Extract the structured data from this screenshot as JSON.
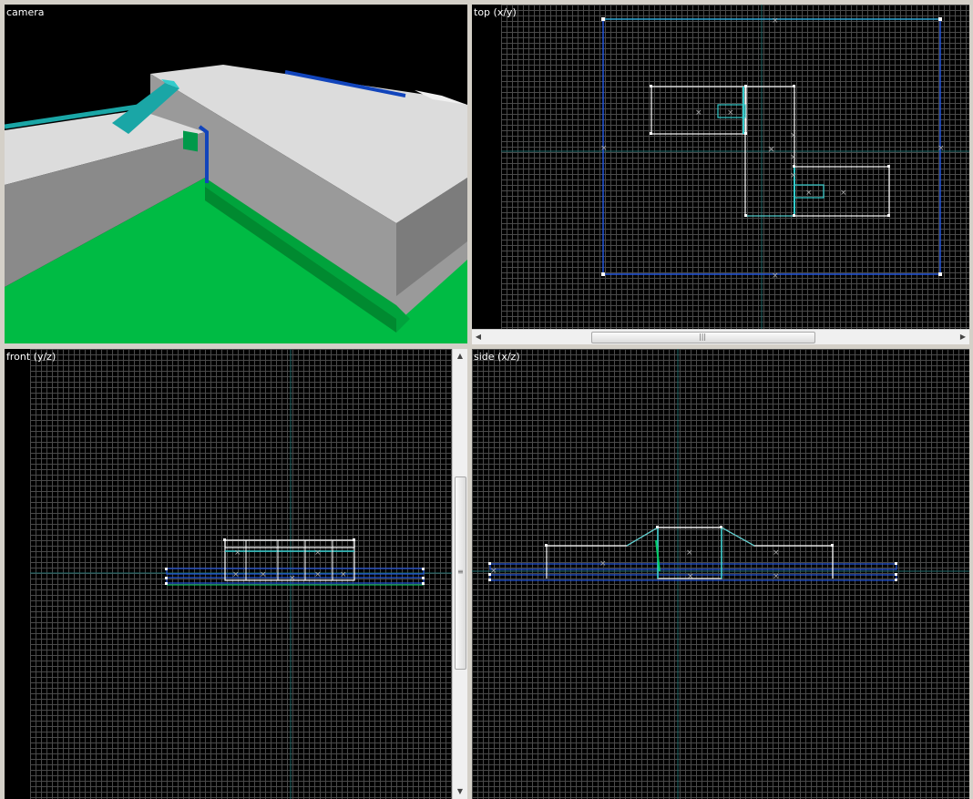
{
  "viewports": {
    "camera": {
      "label": "camera"
    },
    "top": {
      "label": "top (x/y)"
    },
    "front": {
      "label": "front (y/z)"
    },
    "side": {
      "label": "side (x/z)"
    }
  },
  "colors": {
    "background": "#000000",
    "grid_line": "#4a4a4a",
    "brush_white": "#ffffff",
    "brush_blue": "#2255dd",
    "brush_cyan": "#33cccc",
    "axis_line": "#1c6a6a",
    "floor_green": "#00bb44",
    "wall_light": "#dcdcdc",
    "wall_dark": "#8a8a8a",
    "ramp_cyan": "#1aa6a6",
    "trim_blue": "#1144bb"
  },
  "icons": {
    "scroll_left": "arrow-left-icon",
    "scroll_right": "arrow-right-icon",
    "scroll_up": "arrow-up-icon",
    "scroll_down": "arrow-down-icon"
  }
}
